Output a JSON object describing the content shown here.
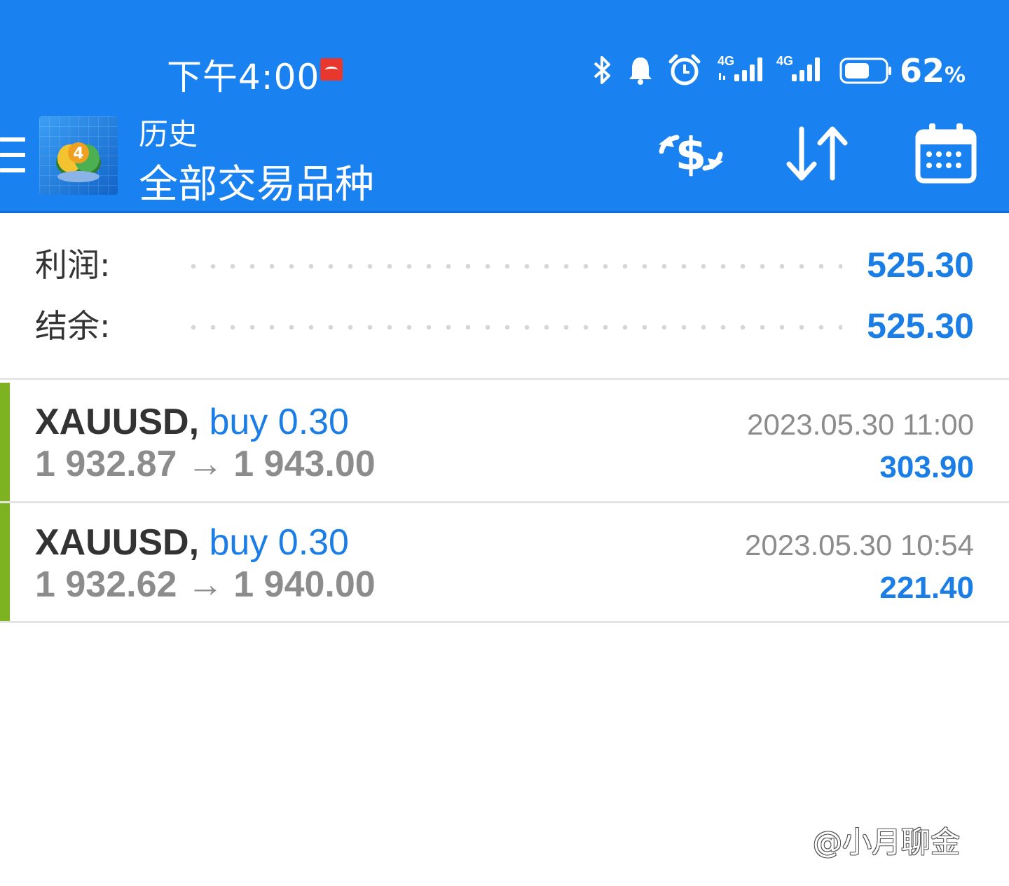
{
  "status_bar": {
    "time": "下午4:00",
    "signal1_label": "4G",
    "signal2_label": "4G",
    "battery": "62",
    "battery_unit": "%"
  },
  "header": {
    "title_small": "历史",
    "title_main": "全部交易品种",
    "icons": [
      "menu-icon",
      "metatrader-logo",
      "currency-exchange-icon",
      "sort-icon",
      "calendar-icon"
    ]
  },
  "summary": {
    "profit_label": "利润:",
    "profit_value": "525.30",
    "balance_label": "结余:",
    "balance_value": "525.30"
  },
  "trades": [
    {
      "symbol": "XAUUSD",
      "side": "buy 0.30",
      "prices": "1 932.87 → 1 943.00",
      "time": "2023.05.30 11:00",
      "profit": "303.90"
    },
    {
      "symbol": "XAUUSD",
      "side": "buy 0.30",
      "prices": "1 932.62 → 1 940.00",
      "time": "2023.05.30 10:54",
      "profit": "221.40"
    }
  ],
  "watermark": "@小月聊金",
  "colors": {
    "header_bg": "#1a82f0",
    "accent_blue": "#1a7ee6",
    "buy_bar": "#7db320",
    "muted_text": "#8c8c8c"
  }
}
